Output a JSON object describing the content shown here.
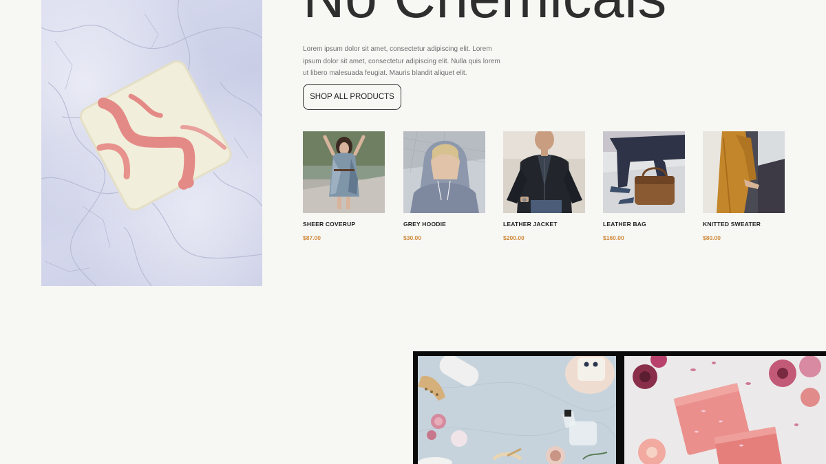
{
  "hero": {
    "headline": "No Chemicals",
    "description": "Lorem ipsum dolor sit amet, consectetur adipiscing elit. Lorem ipsum dolor sit amet, consectetur adipiscing elit. Nulla quis lorem ut libero malesuada feugiat. Mauris blandit aliquet elit.",
    "cta_label": "SHOP ALL PRODUCTS"
  },
  "products": [
    {
      "name": "SHEER COVERUP",
      "price": "$87.00"
    },
    {
      "name": "GREY HOODIE",
      "price": "$30.00"
    },
    {
      "name": "LEATHER JACKET",
      "price": "$200.00"
    },
    {
      "name": "LEATHER BAG",
      "price": "$160.00"
    },
    {
      "name": "KNITTED SWEATER",
      "price": "$80.00"
    }
  ],
  "colors": {
    "background": "#f7f7f4",
    "heading": "#2e2e2e",
    "price": "#d08a3c",
    "button_border": "#333333"
  }
}
